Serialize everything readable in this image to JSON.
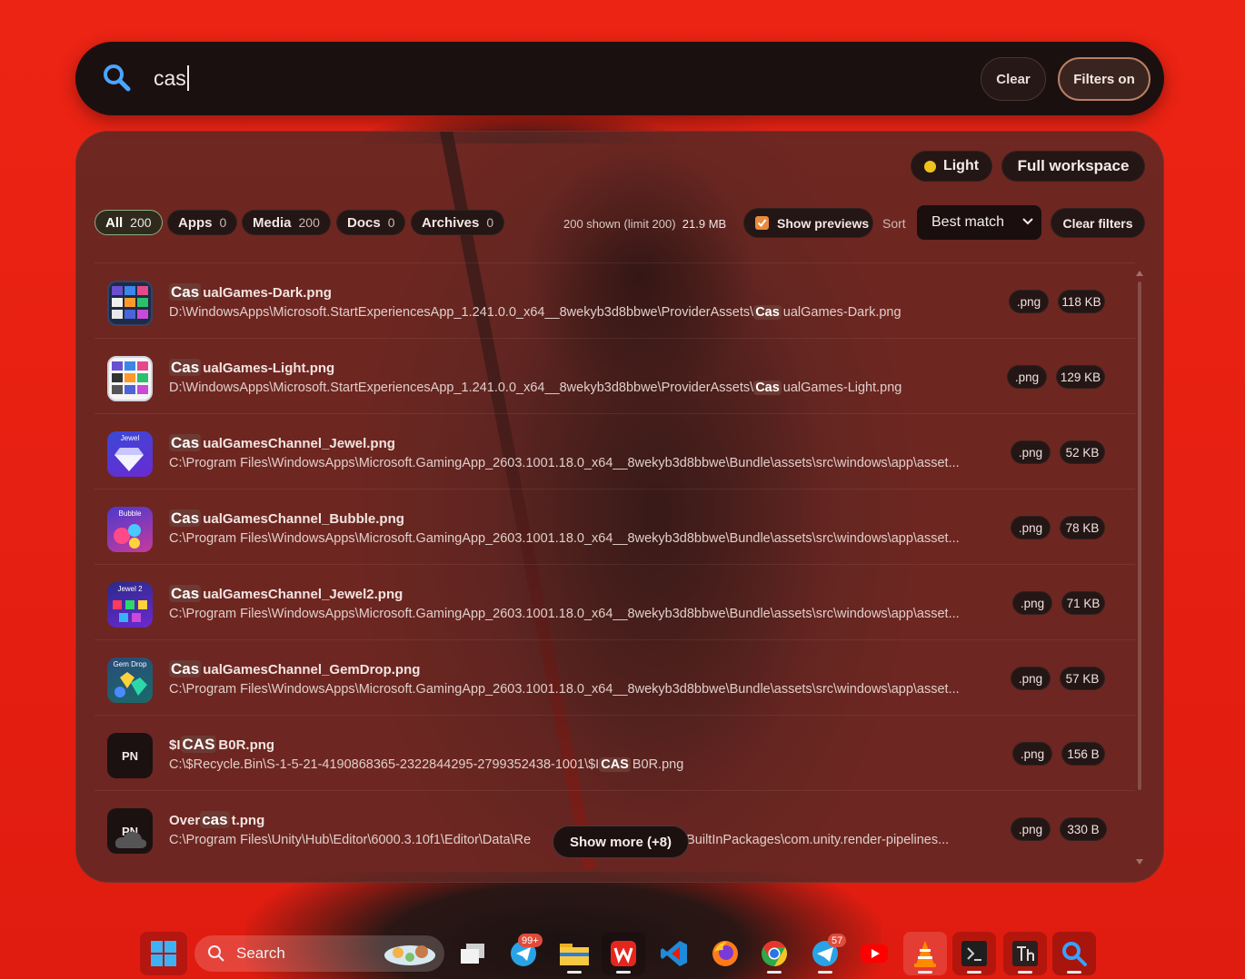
{
  "search": {
    "query": "cas",
    "clear_label": "Clear",
    "filters_label": "Filters on"
  },
  "panel": {
    "theme_label": "Light",
    "workspace_label": "Full workspace",
    "categories": [
      {
        "label": "All",
        "count": "200"
      },
      {
        "label": "Apps",
        "count": "0"
      },
      {
        "label": "Media",
        "count": "200"
      },
      {
        "label": "Docs",
        "count": "0"
      },
      {
        "label": "Archives",
        "count": "0"
      }
    ],
    "stats_shown": "200 shown (limit 200)",
    "stats_size": "21.9 MB",
    "show_previews_label": "Show previews",
    "sort_label": "Sort",
    "sort_value": "Best match",
    "clear_filters_label": "Clear filters",
    "show_more_label": "Show more (+8)"
  },
  "results": [
    {
      "name_pre": "",
      "name_match": "Cas",
      "name_post": "ualGames-Dark.png",
      "path_pre": "D:\\WindowsApps\\Microsoft.StartExperiencesApp_1.241.0.0_x64__8wekyb3d8bbwe\\ProviderAssets\\",
      "path_match": "Cas",
      "path_post": "ualGames-Dark.png",
      "ext": ".png",
      "size": "118 KB",
      "thumb": "casual-games-dark-icon"
    },
    {
      "name_pre": "",
      "name_match": "Cas",
      "name_post": "ualGames-Light.png",
      "path_pre": "D:\\WindowsApps\\Microsoft.StartExperiencesApp_1.241.0.0_x64__8wekyb3d8bbwe\\ProviderAssets\\",
      "path_match": "Cas",
      "path_post": "ualGames-Light.png",
      "ext": ".png",
      "size": "129 KB",
      "thumb": "casual-games-light-icon"
    },
    {
      "name_pre": "",
      "name_match": "Cas",
      "name_post": "ualGamesChannel_Jewel.png",
      "path_pre": "C:\\Program Files\\WindowsApps\\Microsoft.GamingApp_2603.1001.18.0_x64__8wekyb3d8bbwe\\Bundle\\assets\\src\\windows\\app\\asset...",
      "path_match": "",
      "path_post": "",
      "ext": ".png",
      "size": "52 KB",
      "thumb": "jewel-game-icon",
      "thumb_text": "Jewel"
    },
    {
      "name_pre": "",
      "name_match": "Cas",
      "name_post": "ualGamesChannel_Bubble.png",
      "path_pre": "C:\\Program Files\\WindowsApps\\Microsoft.GamingApp_2603.1001.18.0_x64__8wekyb3d8bbwe\\Bundle\\assets\\src\\windows\\app\\asset...",
      "path_match": "",
      "path_post": "",
      "ext": ".png",
      "size": "78 KB",
      "thumb": "bubble-game-icon",
      "thumb_text": "Bubble"
    },
    {
      "name_pre": "",
      "name_match": "Cas",
      "name_post": "ualGamesChannel_Jewel2.png",
      "path_pre": "C:\\Program Files\\WindowsApps\\Microsoft.GamingApp_2603.1001.18.0_x64__8wekyb3d8bbwe\\Bundle\\assets\\src\\windows\\app\\asset...",
      "path_match": "",
      "path_post": "",
      "ext": ".png",
      "size": "71 KB",
      "thumb": "jewel2-game-icon",
      "thumb_text": "Jewel 2"
    },
    {
      "name_pre": "",
      "name_match": "Cas",
      "name_post": "ualGamesChannel_GemDrop.png",
      "path_pre": "C:\\Program Files\\WindowsApps\\Microsoft.GamingApp_2603.1001.18.0_x64__8wekyb3d8bbwe\\Bundle\\assets\\src\\windows\\app\\asset...",
      "path_match": "",
      "path_post": "",
      "ext": ".png",
      "size": "57 KB",
      "thumb": "gem-drop-game-icon",
      "thumb_text": "Gem Drop"
    },
    {
      "name_pre": "$I",
      "name_match": "CAS",
      "name_post": "B0R.png",
      "path_pre": "C:\\$Recycle.Bin\\S-1-5-21-4190868365-2322844295-2799352438-1001\\$I",
      "path_match": "CAS",
      "path_post": "B0R.png",
      "ext": ".png",
      "size": "156 B",
      "thumb": "png-file-icon",
      "thumb_text": "PN"
    },
    {
      "name_pre": "Over",
      "name_match": "cas",
      "name_post": "t.png",
      "path_pre": "C:\\Program Files\\Unity\\Hub\\Editor\\6000.3.10f1\\Editor\\Data\\Re",
      "path_match": "",
      "path_post": "ger\\BuiltInPackages\\com.unity.render-pipelines...",
      "ext": ".png",
      "size": "330 B",
      "thumb": "overcast-weather-icon",
      "thumb_text": "PN"
    }
  ],
  "taskbar": {
    "search_label": "Search",
    "mail_badge": "99+",
    "telegram_badge": "57",
    "items": [
      "windows-start-icon",
      "task-view-icon",
      "mail-icon",
      "file-explorer-icon",
      "wps-office-icon",
      "vscode-icon",
      "firefox-icon",
      "chrome-icon",
      "telegram-icon",
      "youtube-icon",
      "vlc-icon",
      "terminal-icon",
      "typography-app-icon",
      "search-app-icon"
    ]
  },
  "colors": {
    "wallpaper": "#e41c10",
    "panel": "#5a2824",
    "accent_highlight": "#6c3a33",
    "filters_border": "#b78062",
    "checkbox": "#e88a3d"
  }
}
